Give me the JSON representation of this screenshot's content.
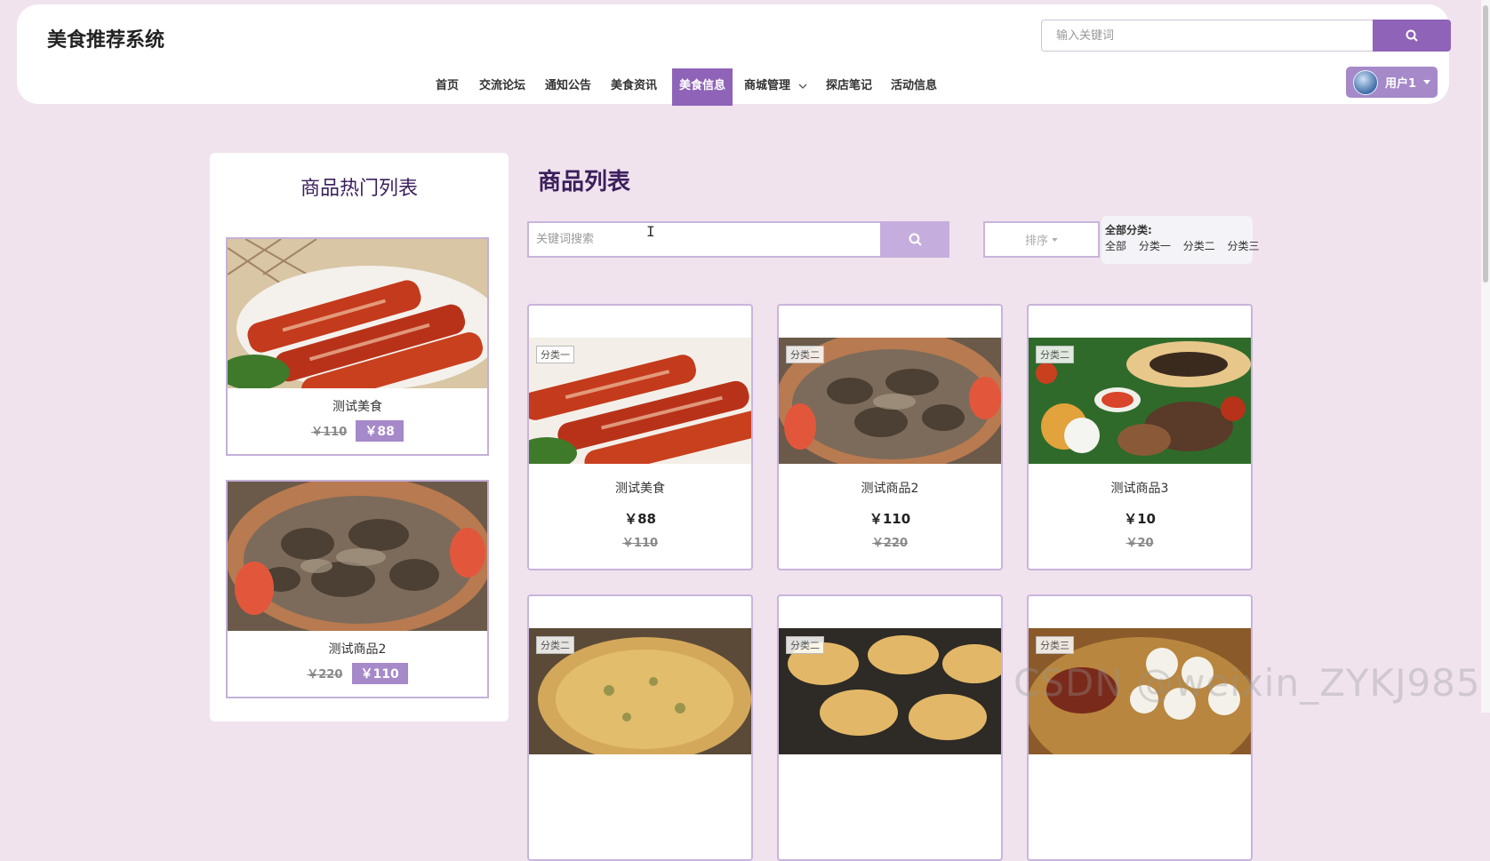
{
  "header": {
    "site_title": "美食推荐系统",
    "search_placeholder": "输入关键词",
    "nav": [
      {
        "label": "首页"
      },
      {
        "label": "交流论坛"
      },
      {
        "label": "通知公告"
      },
      {
        "label": "美食资讯"
      },
      {
        "label": "美食信息",
        "active": true
      },
      {
        "label": "商城管理"
      },
      {
        "label": "探店笔记"
      },
      {
        "label": "活动信息"
      }
    ],
    "user_label": "用户1"
  },
  "hot": {
    "title": "商品热门列表",
    "items": [
      {
        "name": "测试美食",
        "old_price": "￥110",
        "price": "￥88"
      },
      {
        "name": "测试商品2",
        "old_price": "￥220",
        "price": "￥110"
      }
    ]
  },
  "list": {
    "title": "商品列表",
    "search_placeholder": "关键词搜索",
    "sort_label": "排序",
    "category_label": "全部分类:",
    "categories": [
      "全部",
      "分类一",
      "分类二",
      "分类三"
    ],
    "products": [
      {
        "tag": "分类一",
        "name": "测试美食",
        "price": "￥88",
        "old_price": "￥110"
      },
      {
        "tag": "分类二",
        "name": "测试商品2",
        "price": "￥110",
        "old_price": "￥220"
      },
      {
        "tag": "分类二",
        "name": "测试商品3",
        "price": "￥10",
        "old_price": "￥20"
      },
      {
        "tag": "分类二"
      },
      {
        "tag": "分类二"
      },
      {
        "tag": "分类三"
      }
    ]
  },
  "watermark": "CSDN @weixin_ZYKJ985",
  "colors": {
    "accent": "#8f63b8",
    "accent_light": "#a689c9",
    "background": "#f0e3ee",
    "title": "#3b1f5c"
  }
}
